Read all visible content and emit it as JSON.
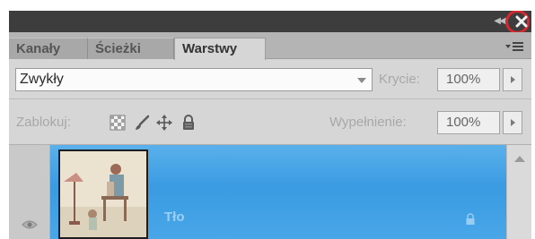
{
  "window": {
    "collapse_icon": "double-left-arrow",
    "close_icon": "close-x",
    "highlight_color": "#d8272f"
  },
  "tabs": [
    {
      "label": "Kanały",
      "active": false
    },
    {
      "label": "Ścieżki",
      "active": false
    },
    {
      "label": "Warstwy",
      "active": true
    }
  ],
  "panel_menu_icon": "panel-menu",
  "blend_mode": {
    "value": "Zwykły"
  },
  "opacity": {
    "label": "Krycie:",
    "value": "100%"
  },
  "lock": {
    "label": "Zablokuj:",
    "icons": [
      "lock-transparency-icon",
      "lock-image-icon",
      "lock-position-icon",
      "lock-all-icon"
    ]
  },
  "fill": {
    "label": "Wypełnienie:",
    "value": "100%"
  },
  "layers": [
    {
      "name": "Tło",
      "selected": true,
      "visible": true,
      "locked": true
    }
  ],
  "colors": {
    "selection": "#3a9be2",
    "panel": "#d6d6d6",
    "titlebar": "#3d3d3d"
  }
}
